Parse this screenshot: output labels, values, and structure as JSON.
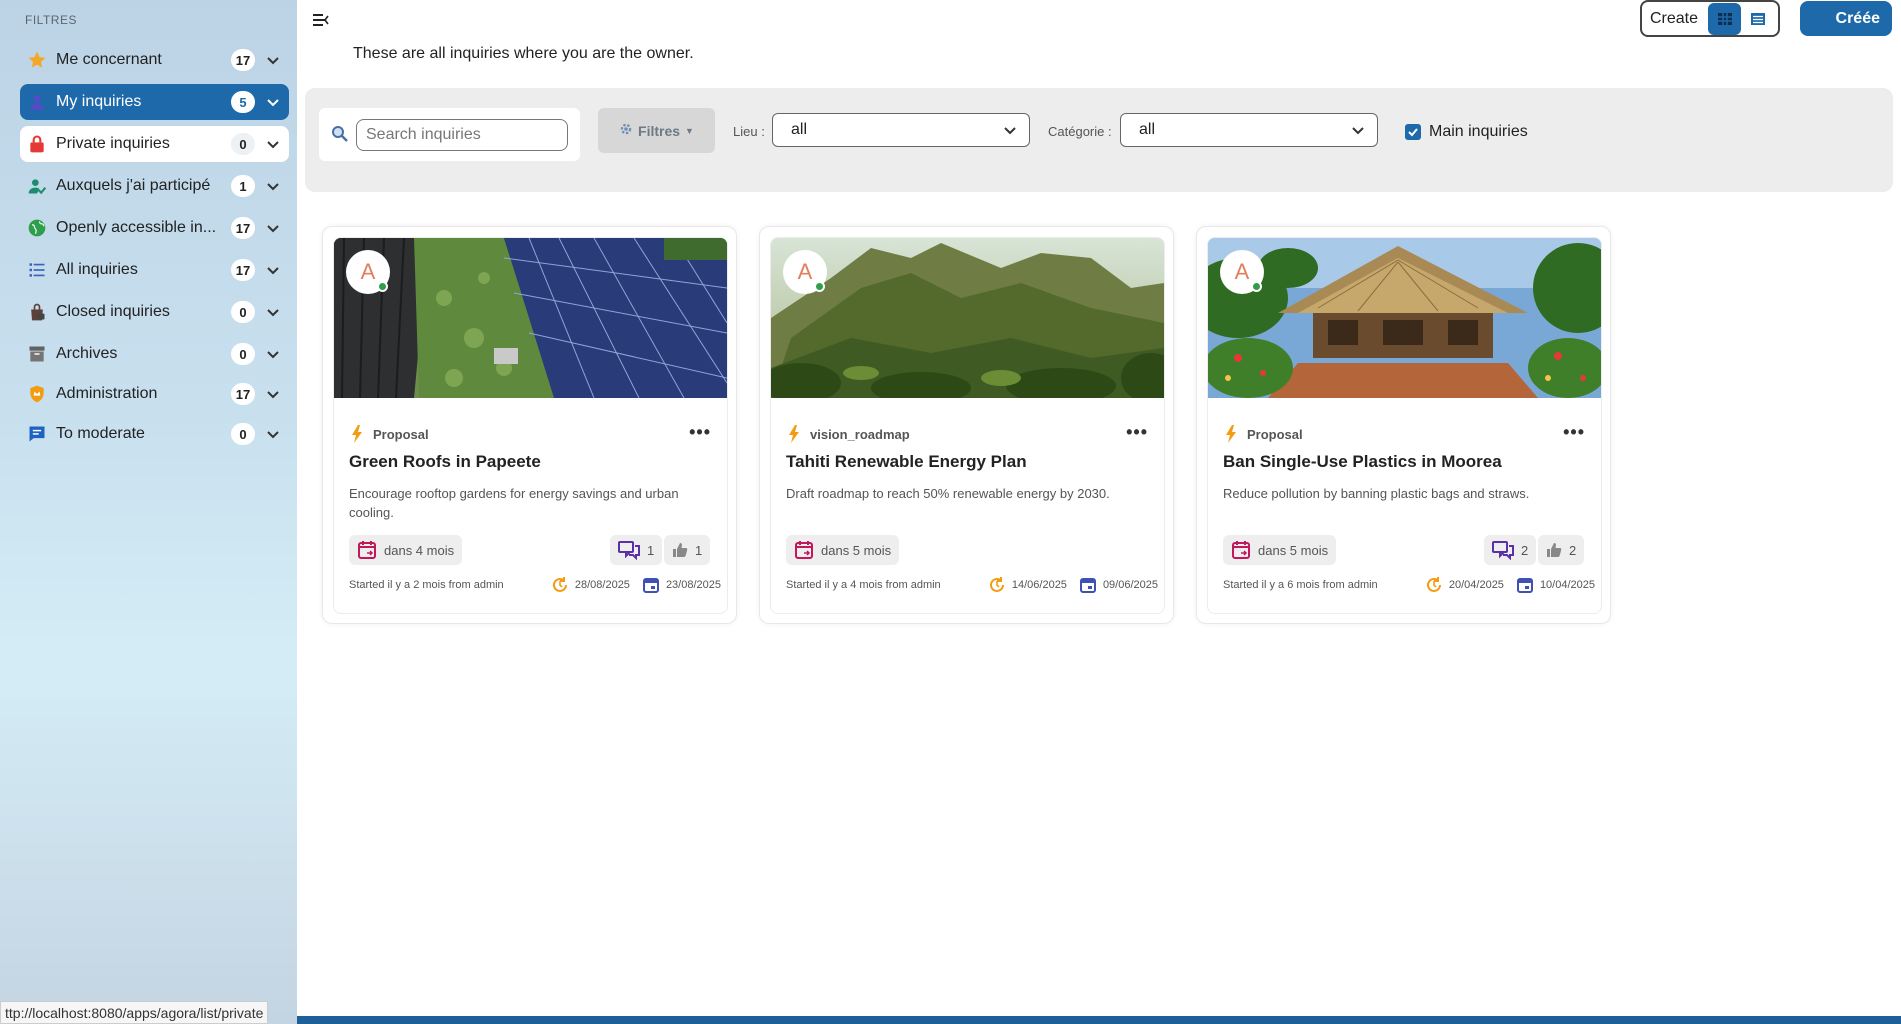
{
  "sidebar": {
    "caption": "FILTRES",
    "items": [
      {
        "label": "Me concernant",
        "count": "17",
        "icon": "star-icon"
      },
      {
        "label": "My inquiries",
        "count": "5",
        "icon": "user-icon"
      },
      {
        "label": "Private inquiries",
        "count": "0",
        "icon": "lock-icon"
      },
      {
        "label": "Auxquels j'ai participé",
        "count": "1",
        "icon": "participant-icon"
      },
      {
        "label": "Openly accessible in...",
        "count": "17",
        "icon": "globe-icon"
      },
      {
        "label": "All inquiries",
        "count": "17",
        "icon": "list-icon"
      },
      {
        "label": "Closed inquiries",
        "count": "0",
        "icon": "locked-bag-icon"
      },
      {
        "label": "Archives",
        "count": "0",
        "icon": "archive-icon"
      },
      {
        "label": "Administration",
        "count": "17",
        "icon": "admin-shield-icon"
      },
      {
        "label": "To moderate",
        "count": "0",
        "icon": "moderate-chat-icon"
      }
    ]
  },
  "status_url": "ttp://localhost:8080/apps/agora/list/private",
  "header": {
    "intro": "These are all inquiries where you are the owner.",
    "view_switch_label": "Create",
    "create_button": "Créée"
  },
  "filters": {
    "search_placeholder": "Search inquiries",
    "filters_button": "Filtres",
    "lieu_label": "Lieu :",
    "lieu_value": "all",
    "categorie_label": "Catégorie :",
    "categorie_value": "all",
    "main_checkbox_label": "Main inquiries"
  },
  "cards": [
    {
      "avatar": "A",
      "type": "Proposal",
      "title": "Green Roofs in Papeete",
      "description": "Encourage rooftop gardens for energy savings and urban cooling.",
      "deadline": "dans 4 mois",
      "comments": "1",
      "likes": "1",
      "started": "Started il y a 2 mois from admin",
      "updated": "28/08/2025",
      "created": "23/08/2025"
    },
    {
      "avatar": "A",
      "type": "vision_roadmap",
      "title": "Tahiti Renewable Energy Plan",
      "description": "Draft roadmap to reach 50% renewable energy by 2030.",
      "deadline": "dans 5 mois",
      "comments": "",
      "likes": "",
      "started": "Started il y a 4 mois from admin",
      "updated": "14/06/2025",
      "created": "09/06/2025"
    },
    {
      "avatar": "A",
      "type": "Proposal",
      "title": "Ban Single-Use Plastics in Moorea",
      "description": "Reduce pollution by banning plastic bags and straws.",
      "deadline": "dans 5 mois",
      "comments": "2",
      "likes": "2",
      "started": "Started il y a 6 mois from admin",
      "updated": "20/04/2025",
      "created": "10/04/2025"
    }
  ],
  "colors": {
    "accent": "#1d69aa",
    "lightning": "#f39c12",
    "deadline_icon": "#c2185b",
    "comment_icon": "#5b2fa8",
    "updated_icon": "#f39c12",
    "created_icon": "#3f51b5"
  }
}
